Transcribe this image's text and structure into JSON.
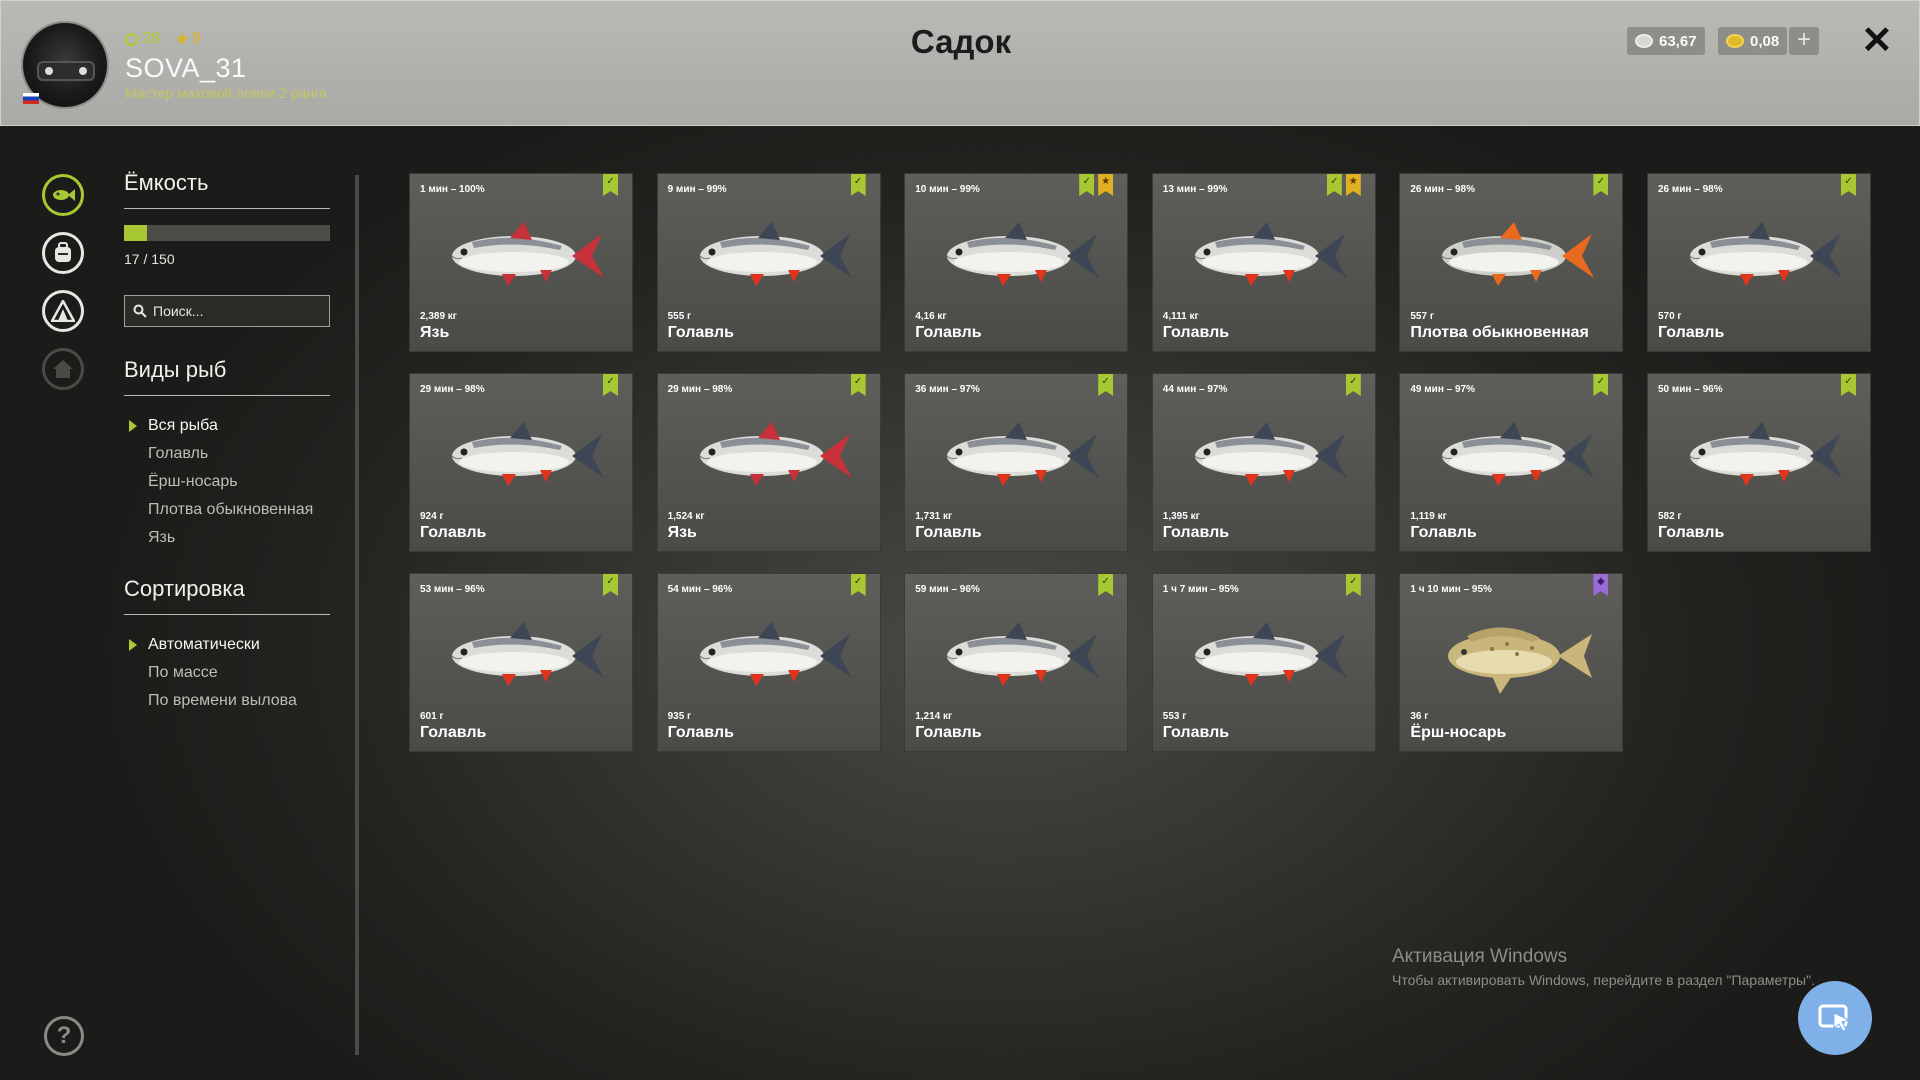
{
  "header": {
    "title": "Садок",
    "user": {
      "name": "SOVA_31",
      "rank": "Мастер маховой ловли 2 ранга",
      "level": "28",
      "stars": "9"
    },
    "currency": {
      "silver": "63,67",
      "gold": "0,08"
    }
  },
  "nav": {
    "icons": [
      "keepnet-icon",
      "backpack-icon",
      "camp-icon",
      "home-icon"
    ],
    "help": "?"
  },
  "capacity": {
    "title": "Ёмкость",
    "used": 17,
    "total": 150,
    "text": "17 / 150"
  },
  "search": {
    "placeholder": "Поиск..."
  },
  "species": {
    "title": "Виды рыб",
    "items": [
      "Вся рыба",
      "Голавль",
      "Ёрш-носарь",
      "Плотва обыкновенная",
      "Язь"
    ],
    "selected": 0
  },
  "sorting": {
    "title": "Сортировка",
    "items": [
      "Автоматически",
      "По массе",
      "По времени вылова"
    ],
    "selected": 0
  },
  "fish": [
    {
      "time": "1 мин – 100%",
      "weight": "2,389 кг",
      "name": "Язь",
      "badges": [
        "green"
      ],
      "kind": "ide"
    },
    {
      "time": "9 мин – 99%",
      "weight": "555 г",
      "name": "Голавль",
      "badges": [
        "green"
      ],
      "kind": "chub"
    },
    {
      "time": "10 мин – 99%",
      "weight": "4,16 кг",
      "name": "Голавль",
      "badges": [
        "green",
        "gold"
      ],
      "kind": "chub"
    },
    {
      "time": "13 мин – 99%",
      "weight": "4,111 кг",
      "name": "Голавль",
      "badges": [
        "green",
        "gold"
      ],
      "kind": "chub"
    },
    {
      "time": "26 мин – 98%",
      "weight": "557 г",
      "name": "Плотва обыкновенная",
      "badges": [
        "green"
      ],
      "kind": "roach"
    },
    {
      "time": "26 мин – 98%",
      "weight": "570 г",
      "name": "Голавль",
      "badges": [
        "green"
      ],
      "kind": "chub"
    },
    {
      "time": "29 мин – 98%",
      "weight": "924 г",
      "name": "Голавль",
      "badges": [
        "green"
      ],
      "kind": "chub"
    },
    {
      "time": "29 мин – 98%",
      "weight": "1,524 кг",
      "name": "Язь",
      "badges": [
        "green"
      ],
      "kind": "ide"
    },
    {
      "time": "36 мин – 97%",
      "weight": "1,731 кг",
      "name": "Голавль",
      "badges": [
        "green"
      ],
      "kind": "chub"
    },
    {
      "time": "44 мин – 97%",
      "weight": "1,395 кг",
      "name": "Голавль",
      "badges": [
        "green"
      ],
      "kind": "chub"
    },
    {
      "time": "49 мин – 97%",
      "weight": "1,119 кг",
      "name": "Голавль",
      "badges": [
        "green"
      ],
      "kind": "chub"
    },
    {
      "time": "50 мин – 96%",
      "weight": "582 г",
      "name": "Голавль",
      "badges": [
        "green"
      ],
      "kind": "chub"
    },
    {
      "time": "53 мин – 96%",
      "weight": "601 г",
      "name": "Голавль",
      "badges": [
        "green"
      ],
      "kind": "chub"
    },
    {
      "time": "54 мин – 96%",
      "weight": "935 г",
      "name": "Голавль",
      "badges": [
        "green"
      ],
      "kind": "chub"
    },
    {
      "time": "59 мин – 96%",
      "weight": "1,214 кг",
      "name": "Голавль",
      "badges": [
        "green"
      ],
      "kind": "chub"
    },
    {
      "time": "1 ч 7 мин – 95%",
      "weight": "553 г",
      "name": "Голавль",
      "badges": [
        "green"
      ],
      "kind": "chub"
    },
    {
      "time": "1 ч 10 мин – 95%",
      "weight": "36 г",
      "name": "Ёрш-носарь",
      "badges": [
        "purple"
      ],
      "kind": "ruffe"
    }
  ],
  "watermark": {
    "line1": "Активация Windows",
    "line2": "Чтобы активировать Windows, перейдите в раздел \"Параметры\"."
  },
  "colors": {
    "accent": "#a8c833",
    "gold": "#e0b020",
    "purple": "#9b6bd8",
    "fab": "#7fb0e8"
  }
}
